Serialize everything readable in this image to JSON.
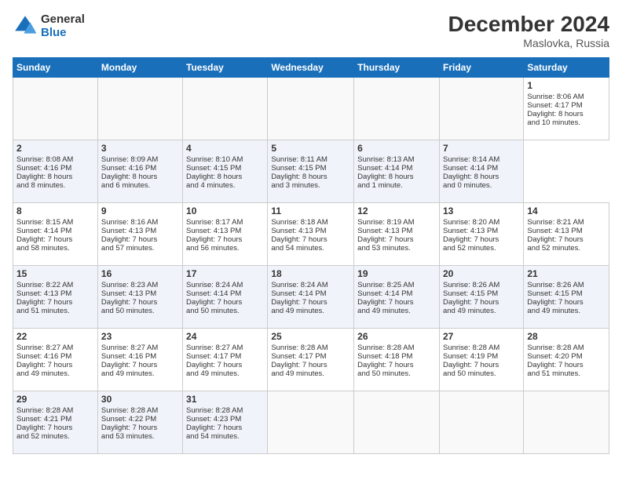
{
  "header": {
    "logo_line1": "General",
    "logo_line2": "Blue",
    "main_title": "December 2024",
    "subtitle": "Maslovka, Russia"
  },
  "calendar": {
    "headers": [
      "Sunday",
      "Monday",
      "Tuesday",
      "Wednesday",
      "Thursday",
      "Friday",
      "Saturday"
    ],
    "weeks": [
      [
        null,
        null,
        null,
        null,
        null,
        null,
        {
          "day": "1",
          "lines": [
            "Sunrise: 8:06 AM",
            "Sunset: 4:17 PM",
            "Daylight: 8 hours",
            "and 10 minutes."
          ]
        }
      ],
      [
        {
          "day": "2",
          "lines": [
            "Sunrise: 8:08 AM",
            "Sunset: 4:16 PM",
            "Daylight: 8 hours",
            "and 8 minutes."
          ]
        },
        {
          "day": "3",
          "lines": [
            "Sunrise: 8:09 AM",
            "Sunset: 4:16 PM",
            "Daylight: 8 hours",
            "and 6 minutes."
          ]
        },
        {
          "day": "4",
          "lines": [
            "Sunrise: 8:10 AM",
            "Sunset: 4:15 PM",
            "Daylight: 8 hours",
            "and 4 minutes."
          ]
        },
        {
          "day": "5",
          "lines": [
            "Sunrise: 8:11 AM",
            "Sunset: 4:15 PM",
            "Daylight: 8 hours",
            "and 3 minutes."
          ]
        },
        {
          "day": "6",
          "lines": [
            "Sunrise: 8:13 AM",
            "Sunset: 4:14 PM",
            "Daylight: 8 hours",
            "and 1 minute."
          ]
        },
        {
          "day": "7",
          "lines": [
            "Sunrise: 8:14 AM",
            "Sunset: 4:14 PM",
            "Daylight: 8 hours",
            "and 0 minutes."
          ]
        }
      ],
      [
        {
          "day": "8",
          "lines": [
            "Sunrise: 8:15 AM",
            "Sunset: 4:14 PM",
            "Daylight: 7 hours",
            "and 58 minutes."
          ]
        },
        {
          "day": "9",
          "lines": [
            "Sunrise: 8:16 AM",
            "Sunset: 4:13 PM",
            "Daylight: 7 hours",
            "and 57 minutes."
          ]
        },
        {
          "day": "10",
          "lines": [
            "Sunrise: 8:17 AM",
            "Sunset: 4:13 PM",
            "Daylight: 7 hours",
            "and 56 minutes."
          ]
        },
        {
          "day": "11",
          "lines": [
            "Sunrise: 8:18 AM",
            "Sunset: 4:13 PM",
            "Daylight: 7 hours",
            "and 54 minutes."
          ]
        },
        {
          "day": "12",
          "lines": [
            "Sunrise: 8:19 AM",
            "Sunset: 4:13 PM",
            "Daylight: 7 hours",
            "and 53 minutes."
          ]
        },
        {
          "day": "13",
          "lines": [
            "Sunrise: 8:20 AM",
            "Sunset: 4:13 PM",
            "Daylight: 7 hours",
            "and 52 minutes."
          ]
        },
        {
          "day": "14",
          "lines": [
            "Sunrise: 8:21 AM",
            "Sunset: 4:13 PM",
            "Daylight: 7 hours",
            "and 52 minutes."
          ]
        }
      ],
      [
        {
          "day": "15",
          "lines": [
            "Sunrise: 8:22 AM",
            "Sunset: 4:13 PM",
            "Daylight: 7 hours",
            "and 51 minutes."
          ]
        },
        {
          "day": "16",
          "lines": [
            "Sunrise: 8:23 AM",
            "Sunset: 4:13 PM",
            "Daylight: 7 hours",
            "and 50 minutes."
          ]
        },
        {
          "day": "17",
          "lines": [
            "Sunrise: 8:24 AM",
            "Sunset: 4:14 PM",
            "Daylight: 7 hours",
            "and 50 minutes."
          ]
        },
        {
          "day": "18",
          "lines": [
            "Sunrise: 8:24 AM",
            "Sunset: 4:14 PM",
            "Daylight: 7 hours",
            "and 49 minutes."
          ]
        },
        {
          "day": "19",
          "lines": [
            "Sunrise: 8:25 AM",
            "Sunset: 4:14 PM",
            "Daylight: 7 hours",
            "and 49 minutes."
          ]
        },
        {
          "day": "20",
          "lines": [
            "Sunrise: 8:26 AM",
            "Sunset: 4:15 PM",
            "Daylight: 7 hours",
            "and 49 minutes."
          ]
        },
        {
          "day": "21",
          "lines": [
            "Sunrise: 8:26 AM",
            "Sunset: 4:15 PM",
            "Daylight: 7 hours",
            "and 49 minutes."
          ]
        }
      ],
      [
        {
          "day": "22",
          "lines": [
            "Sunrise: 8:27 AM",
            "Sunset: 4:16 PM",
            "Daylight: 7 hours",
            "and 49 minutes."
          ]
        },
        {
          "day": "23",
          "lines": [
            "Sunrise: 8:27 AM",
            "Sunset: 4:16 PM",
            "Daylight: 7 hours",
            "and 49 minutes."
          ]
        },
        {
          "day": "24",
          "lines": [
            "Sunrise: 8:27 AM",
            "Sunset: 4:17 PM",
            "Daylight: 7 hours",
            "and 49 minutes."
          ]
        },
        {
          "day": "25",
          "lines": [
            "Sunrise: 8:28 AM",
            "Sunset: 4:17 PM",
            "Daylight: 7 hours",
            "and 49 minutes."
          ]
        },
        {
          "day": "26",
          "lines": [
            "Sunrise: 8:28 AM",
            "Sunset: 4:18 PM",
            "Daylight: 7 hours",
            "and 50 minutes."
          ]
        },
        {
          "day": "27",
          "lines": [
            "Sunrise: 8:28 AM",
            "Sunset: 4:19 PM",
            "Daylight: 7 hours",
            "and 50 minutes."
          ]
        },
        {
          "day": "28",
          "lines": [
            "Sunrise: 8:28 AM",
            "Sunset: 4:20 PM",
            "Daylight: 7 hours",
            "and 51 minutes."
          ]
        }
      ],
      [
        {
          "day": "29",
          "lines": [
            "Sunrise: 8:28 AM",
            "Sunset: 4:21 PM",
            "Daylight: 7 hours",
            "and 52 minutes."
          ]
        },
        {
          "day": "30",
          "lines": [
            "Sunrise: 8:28 AM",
            "Sunset: 4:22 PM",
            "Daylight: 7 hours",
            "and 53 minutes."
          ]
        },
        {
          "day": "31",
          "lines": [
            "Sunrise: 8:28 AM",
            "Sunset: 4:23 PM",
            "Daylight: 7 hours",
            "and 54 minutes."
          ]
        },
        null,
        null,
        null,
        null
      ]
    ]
  }
}
